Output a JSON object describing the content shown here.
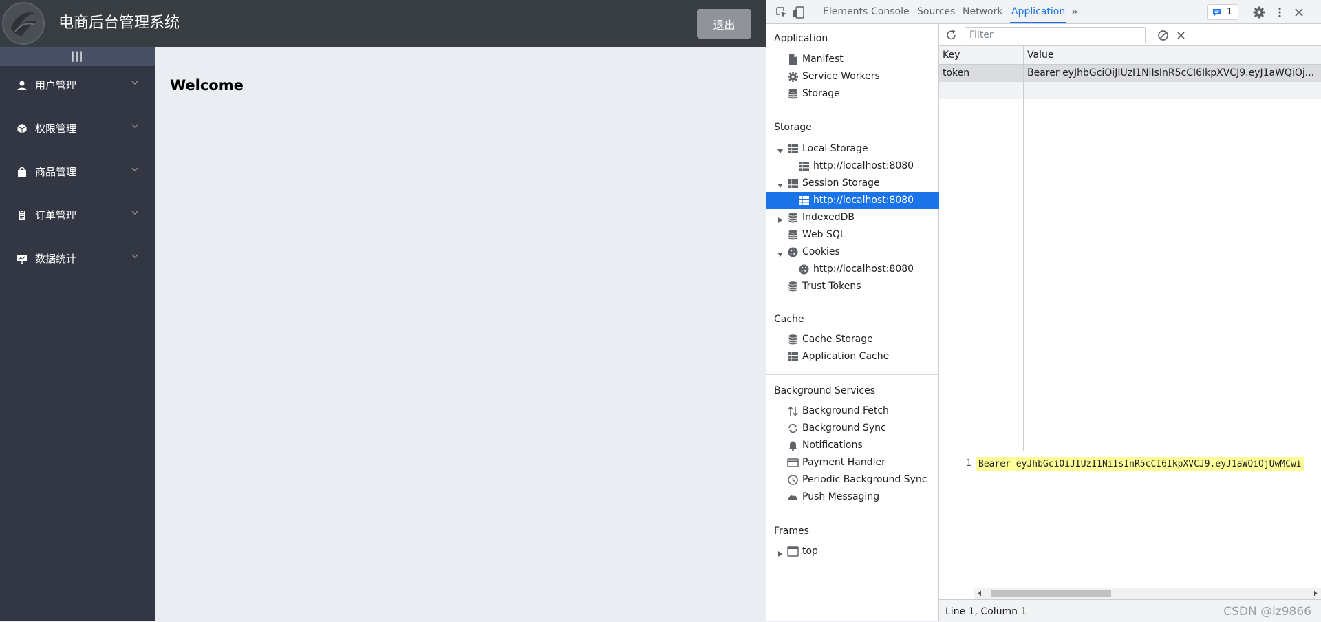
{
  "app": {
    "title": "电商后台管理系统",
    "logout_label": "退出",
    "collapse_label": "|||",
    "welcome": "Welcome",
    "menu": [
      {
        "label": "用户管理",
        "icon": "user-icon"
      },
      {
        "label": "权限管理",
        "icon": "cube-icon"
      },
      {
        "label": "商品管理",
        "icon": "shopping-bag-icon"
      },
      {
        "label": "订单管理",
        "icon": "document-icon"
      },
      {
        "label": "数据统计",
        "icon": "chart-monitor-icon"
      }
    ]
  },
  "devtools": {
    "tabs": [
      "Elements",
      "Console",
      "Sources",
      "Network",
      "Application"
    ],
    "active_tab": "Application",
    "more_tabs": "»",
    "issues_count": "1",
    "sections": {
      "application": {
        "title": "Application",
        "items": [
          "Manifest",
          "Service Workers",
          "Storage"
        ]
      },
      "storage": {
        "title": "Storage",
        "local_storage": "Local Storage",
        "local_storage_origin": "http://localhost:8080",
        "session_storage": "Session Storage",
        "session_storage_origin": "http://localhost:8080",
        "indexeddb": "IndexedDB",
        "websql": "Web SQL",
        "cookies": "Cookies",
        "cookies_origin": "http://localhost:8080",
        "trust_tokens": "Trust Tokens"
      },
      "cache": {
        "title": "Cache",
        "items": [
          "Cache Storage",
          "Application Cache"
        ]
      },
      "background": {
        "title": "Background Services",
        "items": [
          "Background Fetch",
          "Background Sync",
          "Notifications",
          "Payment Handler",
          "Periodic Background Sync",
          "Push Messaging"
        ]
      },
      "frames": {
        "title": "Frames",
        "top": "top"
      }
    },
    "filter_placeholder": "Filter",
    "table": {
      "columns": [
        "Key",
        "Value"
      ],
      "rows": [
        {
          "key": "token",
          "value": "Bearer eyJhbGciOiJIUzI1NiIsInR5cCI6IkpXVCJ9.eyJ1aWQiOj..."
        }
      ]
    },
    "preview": {
      "line_number": "1",
      "content": "Bearer eyJhbGciOiJIUzI1NiIsInR5cCI6IkpXVCJ9.eyJ1aWQiOjUwMCwi"
    },
    "status": "Line 1, Column 1",
    "watermark": "CSDN @lz9866"
  },
  "colors": {
    "header_bg": "#373d41",
    "sidebar_bg": "#333744",
    "main_bg": "#eaedf1",
    "accent": "#1a73e8",
    "highlight": "#ffff99"
  }
}
